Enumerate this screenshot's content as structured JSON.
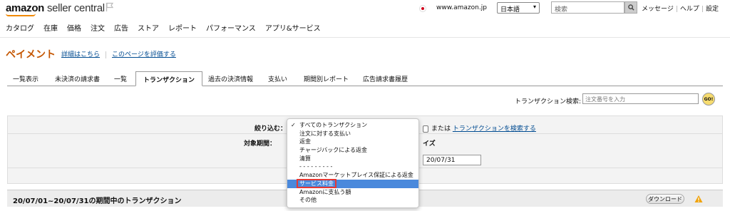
{
  "header": {
    "logo_brand": "amazon",
    "logo_suffix": "seller central",
    "domain": "www.amazon.jp",
    "language": "日本語",
    "search_placeholder": "検索",
    "links": [
      "メッセージ",
      "ヘルプ",
      "設定"
    ]
  },
  "nav": [
    "カタログ",
    "在庫",
    "価格",
    "注文",
    "広告",
    "ストア",
    "レポート",
    "パフォーマンス",
    "アプリ&サービス"
  ],
  "page": {
    "title": "ペイメント",
    "details_link": "詳細はこちら",
    "rate_link": "このページを評価する"
  },
  "tabs": [
    "一覧表示",
    "未決済の請求書",
    "一覧",
    "トランザクション",
    "過去の決済情報",
    "支払い",
    "期間別レポート",
    "広告請求書履歴"
  ],
  "active_tab": "トランザクション",
  "txn_search": {
    "label": "トランザクション検索:",
    "placeholder": "注文番号を入力",
    "go": "GO!"
  },
  "filter": {
    "narrow_label": "絞り込む：",
    "or_text": "または",
    "search_link": "トランザクションを検索する",
    "period_label": "対象期間：",
    "period_size_partial": "イズ",
    "date_value": "20/07/31"
  },
  "dropdown": {
    "items": [
      "すべてのトランザクション",
      "注文に対する支払い",
      "返金",
      "チャージバックによる返金",
      "清算",
      "- - - - - - - - -",
      "Amazonマーケットプレイス保証による返金",
      "サービス料金",
      "Amazonに支払う額",
      "その他"
    ],
    "checked": "すべてのトランザクション",
    "highlighted": "サービス料金"
  },
  "result": {
    "title": "20/07/01~20/07/31の期間中のトランザクション",
    "download": "ダウンロード"
  },
  "colors": {
    "title_orange": "#c45500",
    "link_blue": "#004b91",
    "highlight_blue": "#4a89dc",
    "highlight_box_red": "#e53935"
  }
}
